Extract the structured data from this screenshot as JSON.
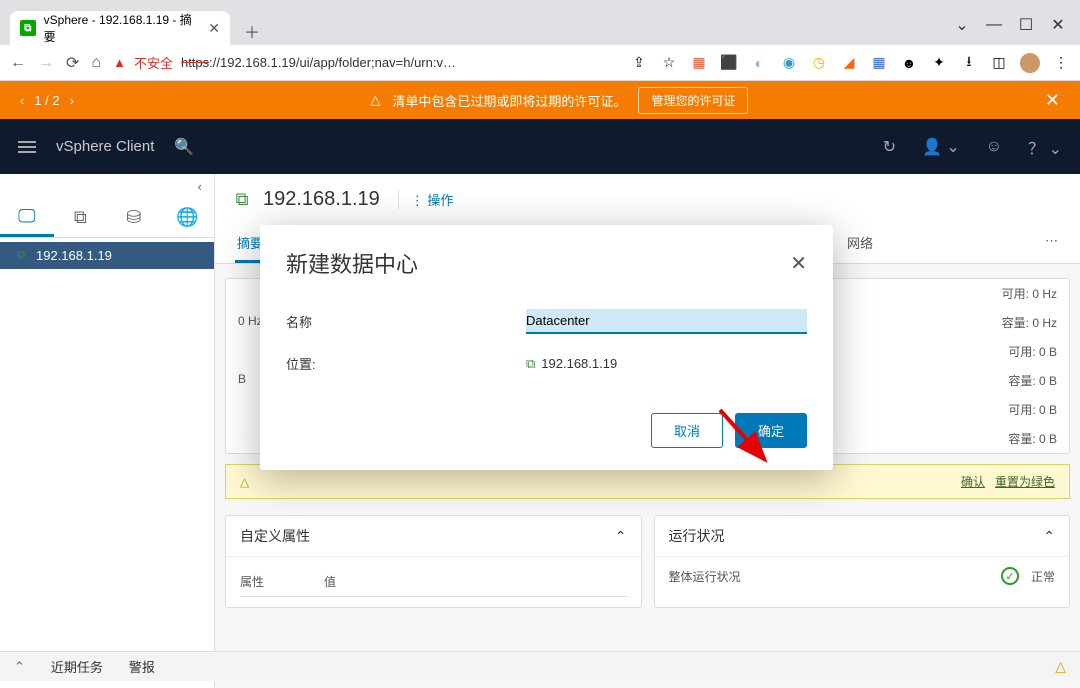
{
  "browser": {
    "tab_title": "vSphere - 192.168.1.19 - 摘要",
    "url_prefix": "不安全",
    "url_scheme": "https",
    "url_rest": "://192.168.1.19/ui/app/folder;nav=h/urn:v…"
  },
  "orange_bar": {
    "nav": "1 / 2",
    "msg": "清单中包含已过期或即将过期的许可证。",
    "button": "管理您的许可证"
  },
  "header": {
    "app": "vSphere Client"
  },
  "sidebar": {
    "item": "192.168.1.19"
  },
  "page": {
    "title": "192.168.1.19",
    "actions_label": "操作",
    "tabs": [
      "摘要",
      "网络"
    ],
    "capacity": [
      {
        "l": "",
        "r": "可用: 0 Hz"
      },
      {
        "l": "0 Hz",
        "r": "容量: 0 Hz"
      },
      {
        "l": "",
        "r": "可用: 0 B"
      },
      {
        "l": "B",
        "r": "容量: 0 B"
      },
      {
        "l": "",
        "r": "可用: 0 B"
      },
      {
        "l": "",
        "r": "容量: 0 B"
      }
    ],
    "alert_links": [
      "确认",
      "重置为绿色"
    ],
    "panels": {
      "left": {
        "title": "自定义属性",
        "col1": "属性",
        "col2": "值"
      },
      "right": {
        "title": "运行状况",
        "label": "整体运行状况",
        "status": "正常"
      }
    }
  },
  "dialog": {
    "title": "新建数据中心",
    "name_label": "名称",
    "name_value": "Datacenter",
    "loc_label": "位置:",
    "loc_value": "192.168.1.19",
    "cancel": "取消",
    "ok": "确定"
  },
  "footer": {
    "tasks": "近期任务",
    "alarms": "警报"
  }
}
